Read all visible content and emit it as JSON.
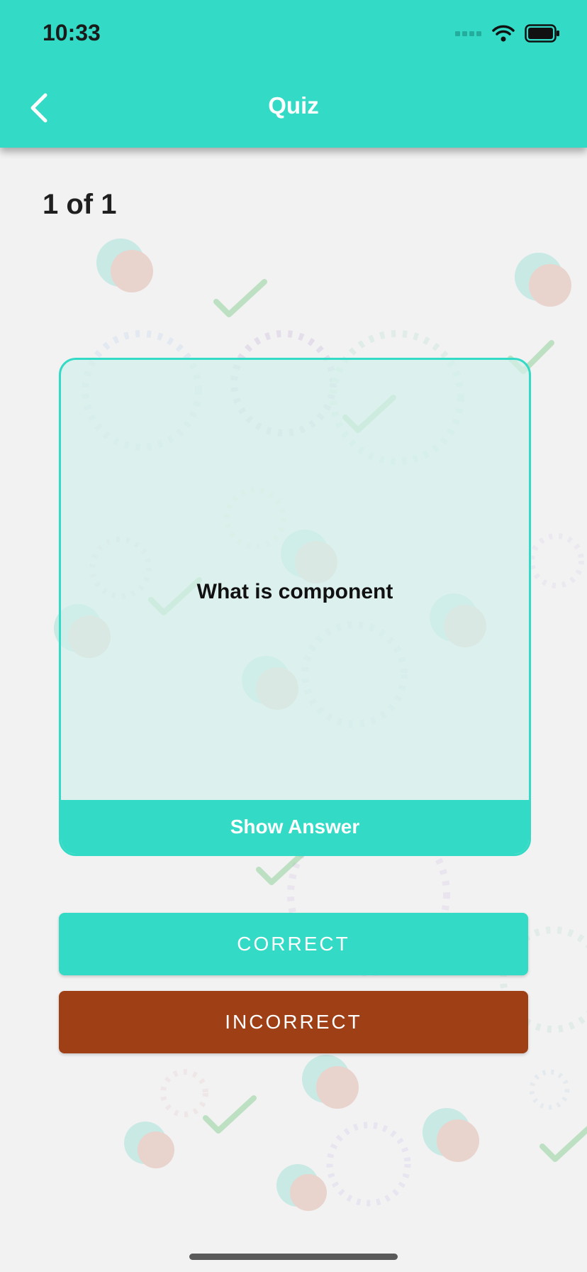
{
  "status_bar": {
    "time": "10:33"
  },
  "nav": {
    "title": "Quiz",
    "back_icon": "chevron-left-icon"
  },
  "quiz": {
    "progress": "1 of 1",
    "question": "What is component",
    "show_answer_label": "Show Answer"
  },
  "actions": {
    "correct_label": "CORRECT",
    "incorrect_label": "INCORRECT"
  },
  "colors": {
    "accent": "#33dac5",
    "incorrect": "#9e3f16",
    "background": "#f2f2f2"
  }
}
